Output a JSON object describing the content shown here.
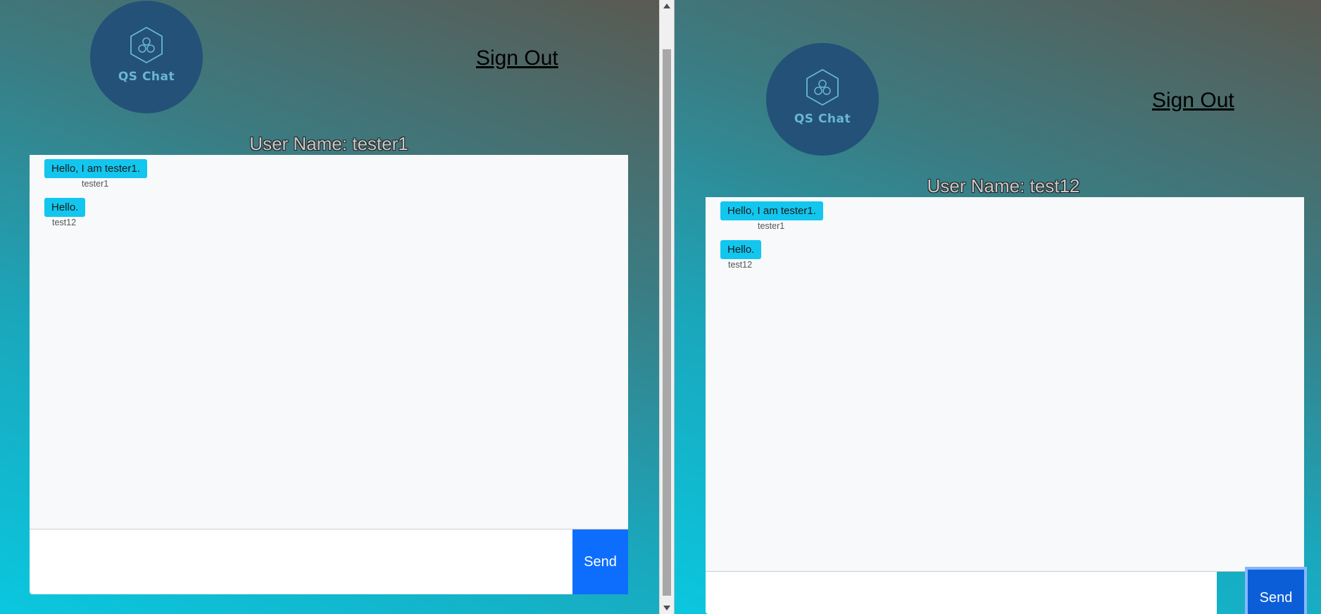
{
  "colors": {
    "logo_bg": "#235178",
    "bubble": "#12c6ee",
    "send_left": "#0d6efd",
    "send_right": "#0b5ed7",
    "send_right_focus_ring": "#86b7fe"
  },
  "left": {
    "logo_text": "QS Chat",
    "sign_out": "Sign Out",
    "user_name": "User Name: tester1",
    "messages": [
      {
        "text": "Hello, I am tester1.",
        "sender": "tester1"
      },
      {
        "text": "Hello.",
        "sender": "test12"
      }
    ],
    "input": {
      "value": "",
      "placeholder": ""
    },
    "send": "Send"
  },
  "right": {
    "logo_text": "QS Chat",
    "sign_out": "Sign Out",
    "user_name": "User Name: test12",
    "messages": [
      {
        "text": "Hello, I am tester1.",
        "sender": "tester1"
      },
      {
        "text": "Hello.",
        "sender": "test12"
      }
    ],
    "input": {
      "value": "",
      "placeholder": ""
    },
    "send": "Send"
  }
}
